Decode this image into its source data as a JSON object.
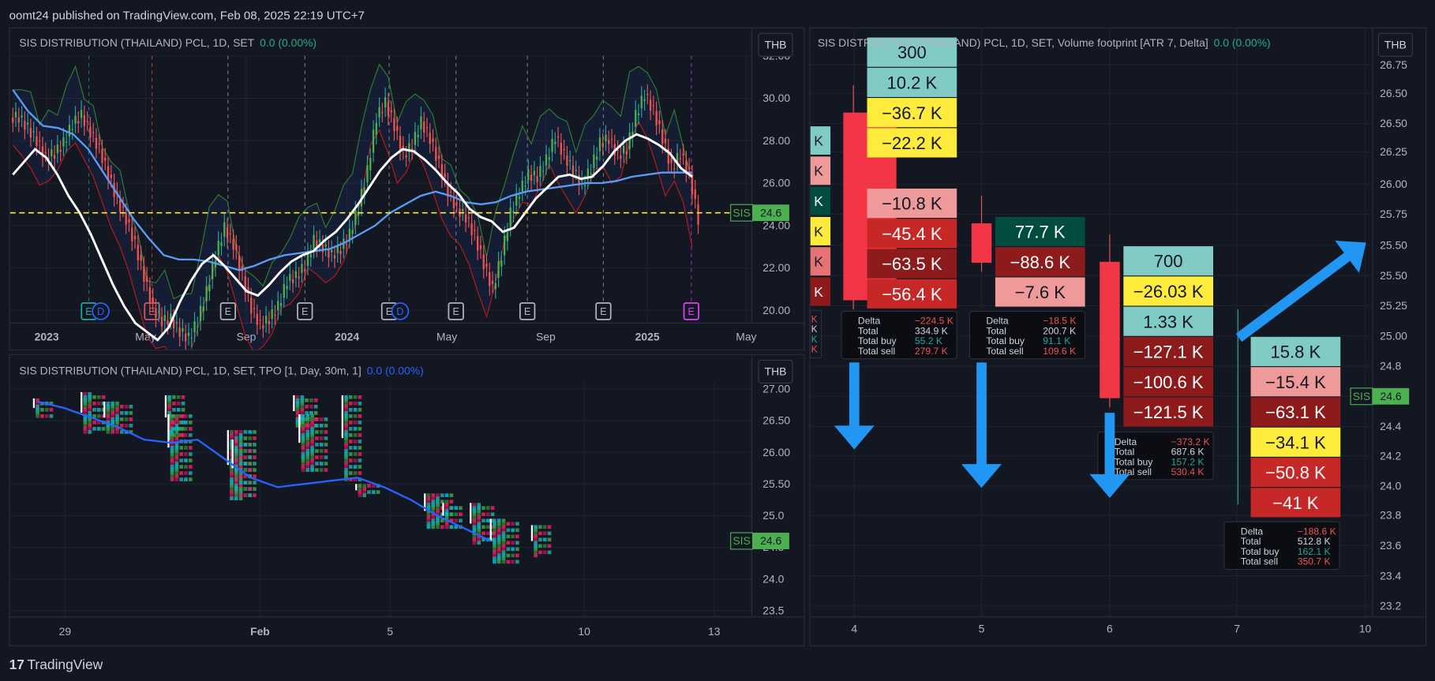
{
  "header": {
    "text": "oomt24 published on TradingView.com, Feb 08, 2025 22:19 UTC+7"
  },
  "footer": {
    "logo_mark": "17",
    "logo_text": "TradingView"
  },
  "colors": {
    "bg": "#131722",
    "up": "#26a69a",
    "down": "#ef5350",
    "grid": "#1e222d",
    "ma_blue": "#5b9cf6",
    "ma_white": "#ffffff",
    "price_line": "#ffeb3b",
    "label_green": "#4caf50"
  },
  "chart_data": [
    {
      "type": "line",
      "name": "price-daily",
      "title": "SIS DISTRIBUTION (THAILAND) PCL, 1D, SET",
      "change_text": "0.0 (0.00%)",
      "currency": "THB",
      "x_ticks": [
        "2023",
        "May",
        "Sep",
        "2024",
        "May",
        "Sep",
        "2025",
        "May"
      ],
      "y_ticks": [
        "32.00",
        "30.00",
        "28.00",
        "26.00",
        "24.00",
        "22.00",
        "20.00"
      ],
      "ylim": [
        19.4,
        32.0
      ],
      "last_price_label": {
        "symbol": "SIS",
        "value": "24.6"
      },
      "price_line": 24.6,
      "event_markers": [
        {
          "x": "Jan 2023",
          "glyph": "E",
          "color": "#26a69a"
        },
        {
          "x": "Jan 2023",
          "glyph": "D",
          "color": "#2962ff"
        },
        {
          "x": "Apr 2023",
          "glyph": "E",
          "color": "#ef5350"
        },
        {
          "x": "Aug 2023",
          "glyph": "E",
          "color": "#b2b5be"
        },
        {
          "x": "Nov 2023",
          "glyph": "E",
          "color": "#b2b5be"
        },
        {
          "x": "Feb 2024",
          "glyph": "E",
          "color": "#b2b5be"
        },
        {
          "x": "Feb 2024",
          "glyph": "D",
          "color": "#2962ff"
        },
        {
          "x": "May 2024",
          "glyph": "E",
          "color": "#b2b5be"
        },
        {
          "x": "Aug 2024",
          "glyph": "E",
          "color": "#b2b5be"
        },
        {
          "x": "Nov 2024",
          "glyph": "E",
          "color": "#b2b5be"
        },
        {
          "x": "Feb 2025",
          "glyph": "E",
          "color": "#e040fb"
        }
      ],
      "series": [
        {
          "name": "close",
          "values": [
            29.1,
            28.6,
            28.0,
            27.2,
            27.4,
            27.9,
            28.8,
            29.2,
            28.4,
            27.6,
            26.4,
            25.2,
            24.3,
            23.1,
            21.6,
            20.1,
            19.5,
            19.6,
            19.0,
            18.7,
            19.5,
            20.9,
            22.6,
            23.9,
            23.1,
            21.6,
            20.1,
            19.3,
            19.6,
            20.2,
            21.4,
            21.6,
            22.1,
            23.3,
            23.0,
            22.6,
            22.9,
            23.6,
            24.9,
            26.6,
            29.1,
            29.8,
            28.7,
            27.3,
            27.8,
            28.9,
            28.1,
            26.9,
            25.6,
            24.8,
            24.4,
            23.5,
            22.2,
            21.0,
            22.6,
            24.6,
            25.6,
            26.4,
            26.3,
            27.1,
            28.2,
            27.3,
            26.6,
            25.9,
            26.7,
            27.9,
            28.1,
            27.3,
            27.6,
            29.2,
            30.2,
            29.4,
            28.1,
            26.7,
            27.4,
            26.4,
            24.3
          ]
        },
        {
          "name": "ema-white",
          "values": [
            26.4,
            27.0,
            27.6,
            27.2,
            26.4,
            25.4,
            24.6,
            23.6,
            22.4,
            21.2,
            20.2,
            19.4,
            19.0,
            18.6,
            19.2,
            20.4,
            21.4,
            22.2,
            22.6,
            22.1,
            21.5,
            20.9,
            20.7,
            21.2,
            21.8,
            22.3,
            22.6,
            22.8,
            23.3,
            23.7,
            24.3,
            25.0,
            25.8,
            26.6,
            27.2,
            27.6,
            27.5,
            27.1,
            26.6,
            26.0,
            25.5,
            24.8,
            24.4,
            24.2,
            23.7,
            23.9,
            24.6,
            25.3,
            25.8,
            26.3,
            26.4,
            26.2,
            26.3,
            26.8,
            27.5,
            28.0,
            28.3,
            28.1,
            27.8,
            27.4,
            26.7,
            26.3
          ]
        },
        {
          "name": "ema-blue",
          "values": [
            30.4,
            29.4,
            28.7,
            28.6,
            28.3,
            27.6,
            26.5,
            25.4,
            24.3,
            23.4,
            22.6,
            22.4,
            22.4,
            22.3,
            22.1,
            21.9,
            22.1,
            22.4,
            22.6,
            22.7,
            22.8,
            22.9,
            23.2,
            23.6,
            24.0,
            24.6,
            25.0,
            25.4,
            25.6,
            25.4,
            25.1,
            25.0,
            25.1,
            25.4,
            25.6,
            25.7,
            25.8,
            25.9,
            26.0,
            26.0,
            26.1,
            26.3,
            26.4,
            26.5,
            26.5,
            26.5
          ]
        }
      ]
    },
    {
      "type": "scatter",
      "name": "tpo-profile",
      "title": "SIS DISTRIBUTION (THAILAND) PCL, 1D, SET, TPO [1, Day, 30m, 1]",
      "change_text": "0.0 (0.00%)",
      "currency": "THB",
      "x_ticks": [
        "29",
        "Feb",
        "5",
        "10",
        "13"
      ],
      "y_ticks": [
        "27.00",
        "26.50",
        "26.00",
        "25.50",
        "25.0",
        "24.5",
        "24.0",
        "23.5"
      ],
      "ylim": [
        23.4,
        27.1
      ],
      "last_price_label": {
        "symbol": "SIS",
        "value": "24.6"
      },
      "poc_line": [
        26.8,
        26.7,
        26.55,
        26.4,
        26.2,
        26.15,
        26.2,
        25.9,
        25.6,
        25.45,
        25.5,
        25.55,
        25.6,
        25.45,
        25.25,
        25.0,
        24.8,
        24.6
      ]
    },
    {
      "type": "bar",
      "name": "volume-footprint",
      "title": "SIS DISTRIBUTION (THAILAND) PCL, 1D, SET, Volume footprint [ATR 7, Delta]",
      "change_text": "0.0 (0.00%)",
      "currency": "THB",
      "x_ticks": [
        "4",
        "5",
        "6",
        "7",
        "10"
      ],
      "y_ticks": [
        "26.75",
        "26.50",
        "26.50",
        "26.25",
        "26.00",
        "25.75",
        "25.50",
        "25.50",
        "25.25",
        "25.00",
        "24.8",
        "24.6",
        "24.4",
        "24.2",
        "24.0",
        "23.8",
        "23.6",
        "23.4",
        "23.2"
      ],
      "last_price_label": {
        "symbol": "SIS",
        "value": "24.6"
      },
      "bars": [
        {
          "x": "4",
          "cells": [
            "300",
            "10.2 K",
            "−36.7 K",
            "−22.2 K",
            "",
            "−10.8 K",
            "−45.4 K",
            "−63.5 K",
            "−56.4 K"
          ],
          "stats": {
            "delta": "−224.5 K",
            "total": "334.9 K",
            "buy": "55.2 K",
            "sell": "279.7 K"
          }
        },
        {
          "x": "5",
          "cells": [
            "77.7 K",
            "−88.6 K",
            "−7.6 K"
          ],
          "stats": {
            "delta": "−18.5 K",
            "total": "200.7 K",
            "buy": "91.1 K",
            "sell": "109.6 K"
          }
        },
        {
          "x": "6",
          "cells": [
            "700",
            "−26.03 K",
            "1.33 K",
            "−127.1 K",
            "−100.6 K",
            "−121.5 K"
          ],
          "stats": {
            "delta": "−373.2 K",
            "total": "687.6 K",
            "buy": "157.2 K",
            "sell": "530.4 K"
          }
        },
        {
          "x": "7",
          "cells": [
            "15.8 K",
            "−15.4 K",
            "−63.1 K",
            "−34.1 K",
            "−50.8 K",
            "−41 K"
          ],
          "stats": {
            "delta": "−188.6 K",
            "total": "512.8 K",
            "buy": "162.1 K",
            "sell": "350.7 K"
          }
        }
      ],
      "stat_labels": {
        "delta": "Delta",
        "total": "Total",
        "buy": "Total buy",
        "sell": "Total sell"
      },
      "partial_left_cells": [
        "K",
        "K",
        "K",
        "K",
        "K",
        "K"
      ],
      "partial_left_stats": [
        "K",
        "K",
        "K",
        "K"
      ]
    }
  ]
}
